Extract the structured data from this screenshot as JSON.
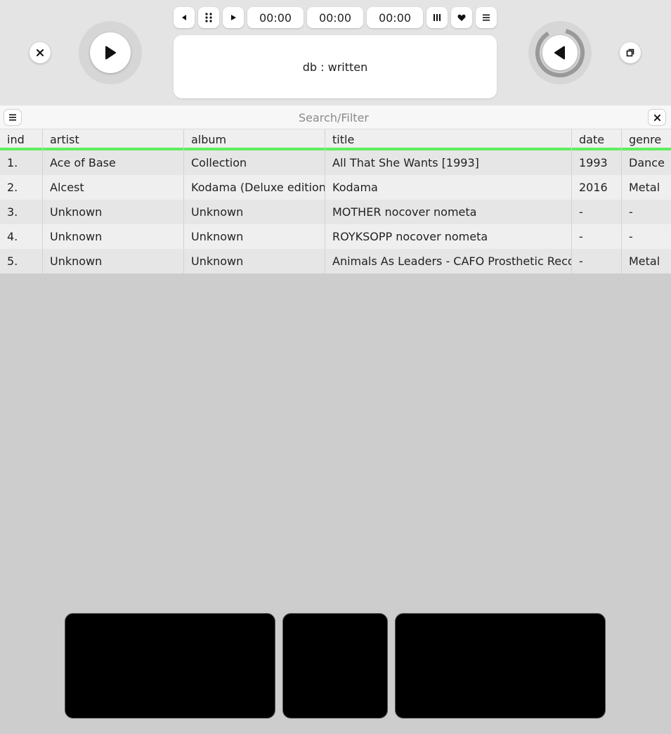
{
  "player": {
    "time_elapsed": "00:00",
    "time_total": "00:00",
    "time_remaining": "00:00",
    "status_text": "db : written"
  },
  "search": {
    "placeholder": "Search/Filter",
    "value": ""
  },
  "table": {
    "columns": [
      "ind",
      "artist",
      "album",
      "title",
      "date",
      "genre"
    ],
    "rows": [
      {
        "ind": "1.",
        "artist": "Ace of Base",
        "album": "Collection",
        "title": "All That She Wants [1993]",
        "date": "1993",
        "genre": "Dance"
      },
      {
        "ind": "2.",
        "artist": "Alcest",
        "album": "Kodama (Deluxe edition)",
        "title": "Kodama",
        "date": "2016",
        "genre": "Metal"
      },
      {
        "ind": "3.",
        "artist": "Unknown",
        "album": "Unknown",
        "title": "MOTHER nocover nometa",
        "date": "-",
        "genre": "-"
      },
      {
        "ind": "4.",
        "artist": "Unknown",
        "album": "Unknown",
        "title": "ROYKSOPP nocover nometa",
        "date": "-",
        "genre": "-"
      },
      {
        "ind": "5.",
        "artist": "Unknown",
        "album": "Unknown",
        "title": "Animals As Leaders -  CAFO  Prosthetic Records",
        "date": "-",
        "genre": "Metal"
      }
    ]
  },
  "colors": {
    "accent_green": "#5eee5e",
    "background": "#cdcdcd",
    "panel_black": "#000000"
  },
  "icons": {
    "prev": "prev-icon",
    "grid": "grid-icon",
    "play": "play-icon",
    "bars": "bars-icon",
    "heart": "heart-icon",
    "menu": "menu-icon",
    "close": "close-icon",
    "restore": "restore-icon",
    "reverse": "reverse-play-icon"
  }
}
